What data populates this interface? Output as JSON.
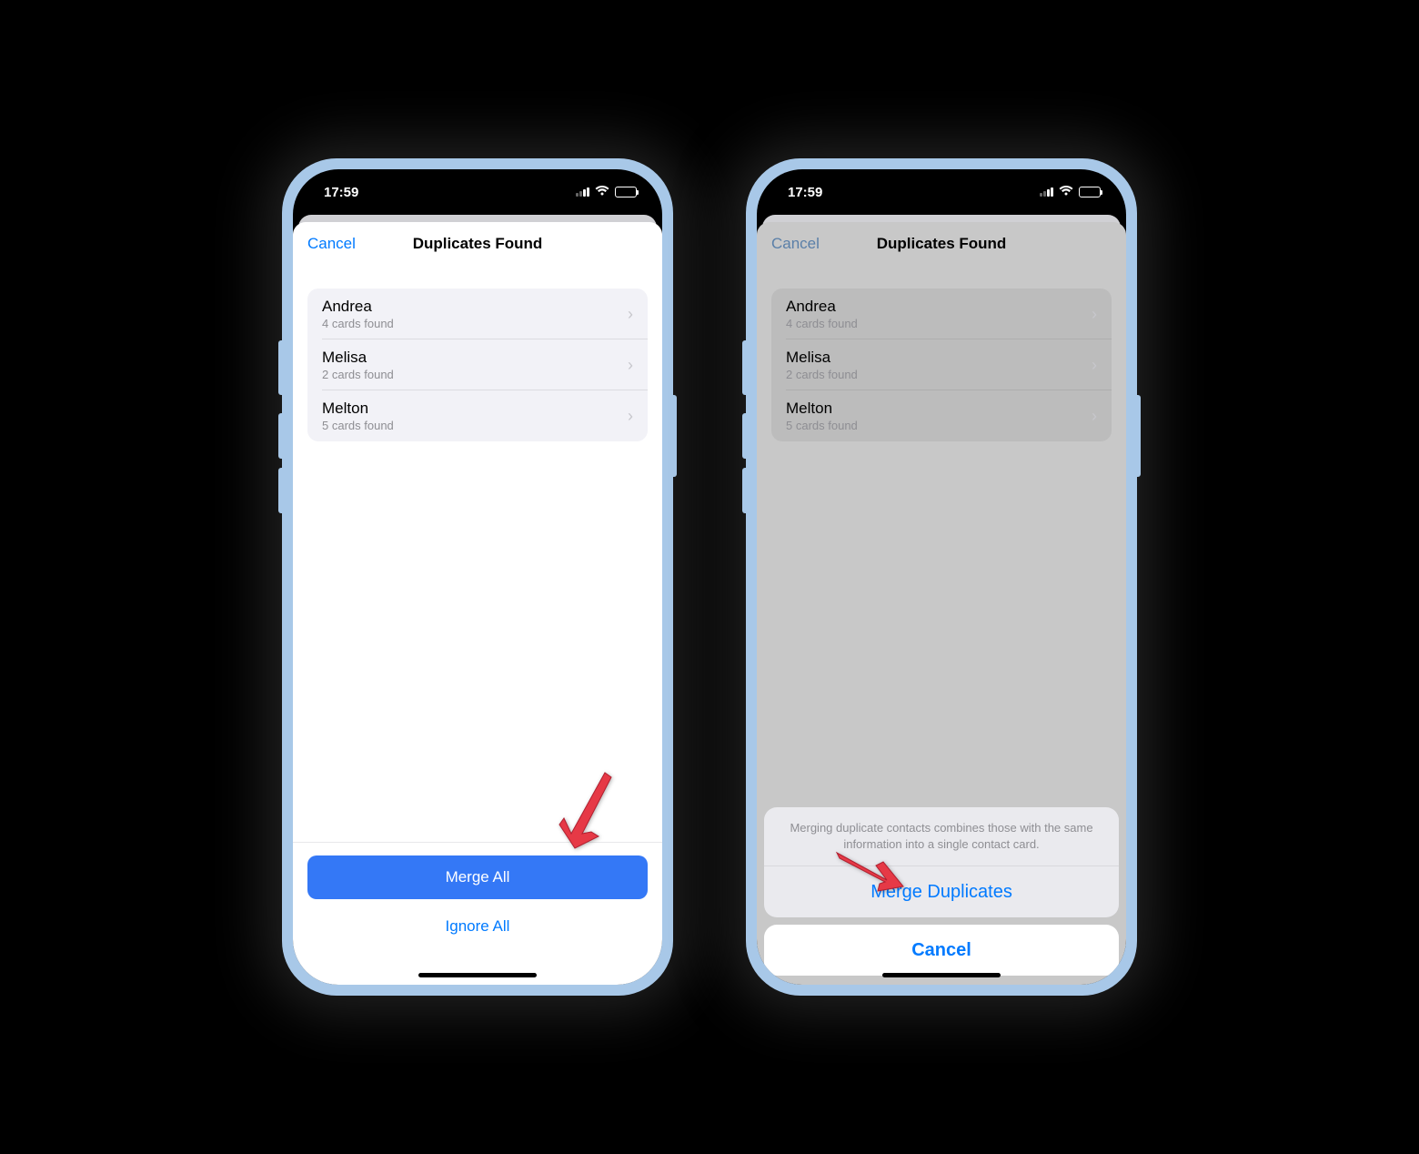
{
  "status": {
    "time": "17:59"
  },
  "header": {
    "cancel": "Cancel",
    "title": "Duplicates Found"
  },
  "duplicates": [
    {
      "name": "Andrea",
      "sub": "4 cards found"
    },
    {
      "name": "Melisa",
      "sub": "2 cards found"
    },
    {
      "name": "Melton",
      "sub": "5 cards found"
    }
  ],
  "buttons": {
    "mergeAll": "Merge All",
    "ignoreAll": "Ignore All"
  },
  "actionSheet": {
    "message": "Merging duplicate contacts combines those with the same information into a single contact card.",
    "mergeDuplicates": "Merge Duplicates",
    "cancel": "Cancel"
  }
}
